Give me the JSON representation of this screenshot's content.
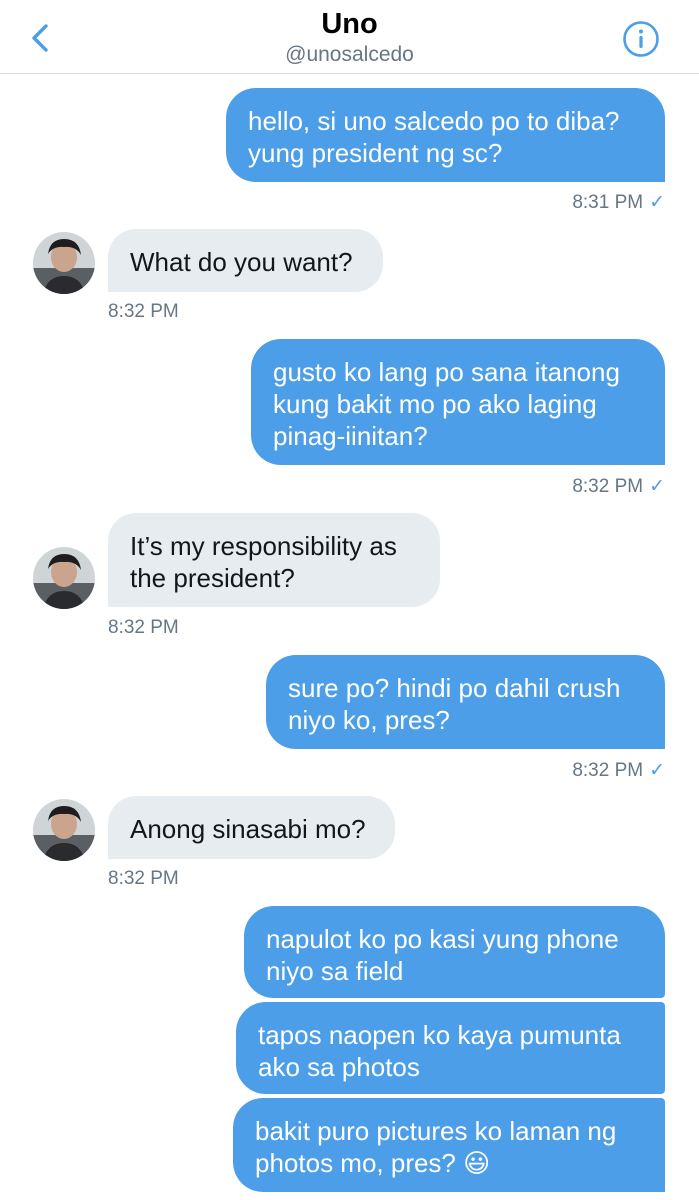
{
  "header": {
    "title": "Uno",
    "handle": "@unosalcedo"
  },
  "messages": [
    {
      "lines": [
        "hello, si uno salcedo po to diba?",
        "yung president ng sc?"
      ],
      "time": "8:31 PM",
      "check": "✓"
    },
    {
      "lines": [
        "What do you want?"
      ],
      "time": "8:32 PM"
    },
    {
      "lines": [
        "gusto ko lang po sana itanong",
        "kung bakit mo po ako laging",
        "pinag-iinitan?"
      ],
      "time": "8:32 PM",
      "check": "✓"
    },
    {
      "lines": [
        "It’s my responsibility as",
        "the president?"
      ],
      "time": "8:32 PM"
    },
    {
      "lines": [
        "sure po? hindi po dahil crush",
        "niyo ko, pres?"
      ],
      "time": "8:32 PM",
      "check": "✓"
    },
    {
      "lines": [
        "Anong sinasabi mo?"
      ],
      "time": "8:32 PM"
    },
    {
      "lines": [
        "napulot ko po kasi yung phone",
        "niyo sa field"
      ]
    },
    {
      "lines": [
        "tapos naopen ko kaya pumunta",
        "ako sa photos"
      ]
    },
    {
      "lines": [
        "bakit puro pictures ko laman ng",
        "photos mo, pres?"
      ],
      "emoji": "😃"
    }
  ],
  "colors": {
    "accent": "#4c9ee8",
    "sent_bubble": "#4c9ee8",
    "received_bubble": "#e6ecf0",
    "secondary_text": "#657786"
  },
  "icons": {
    "back": "chevron-left-icon",
    "info": "info-icon"
  }
}
